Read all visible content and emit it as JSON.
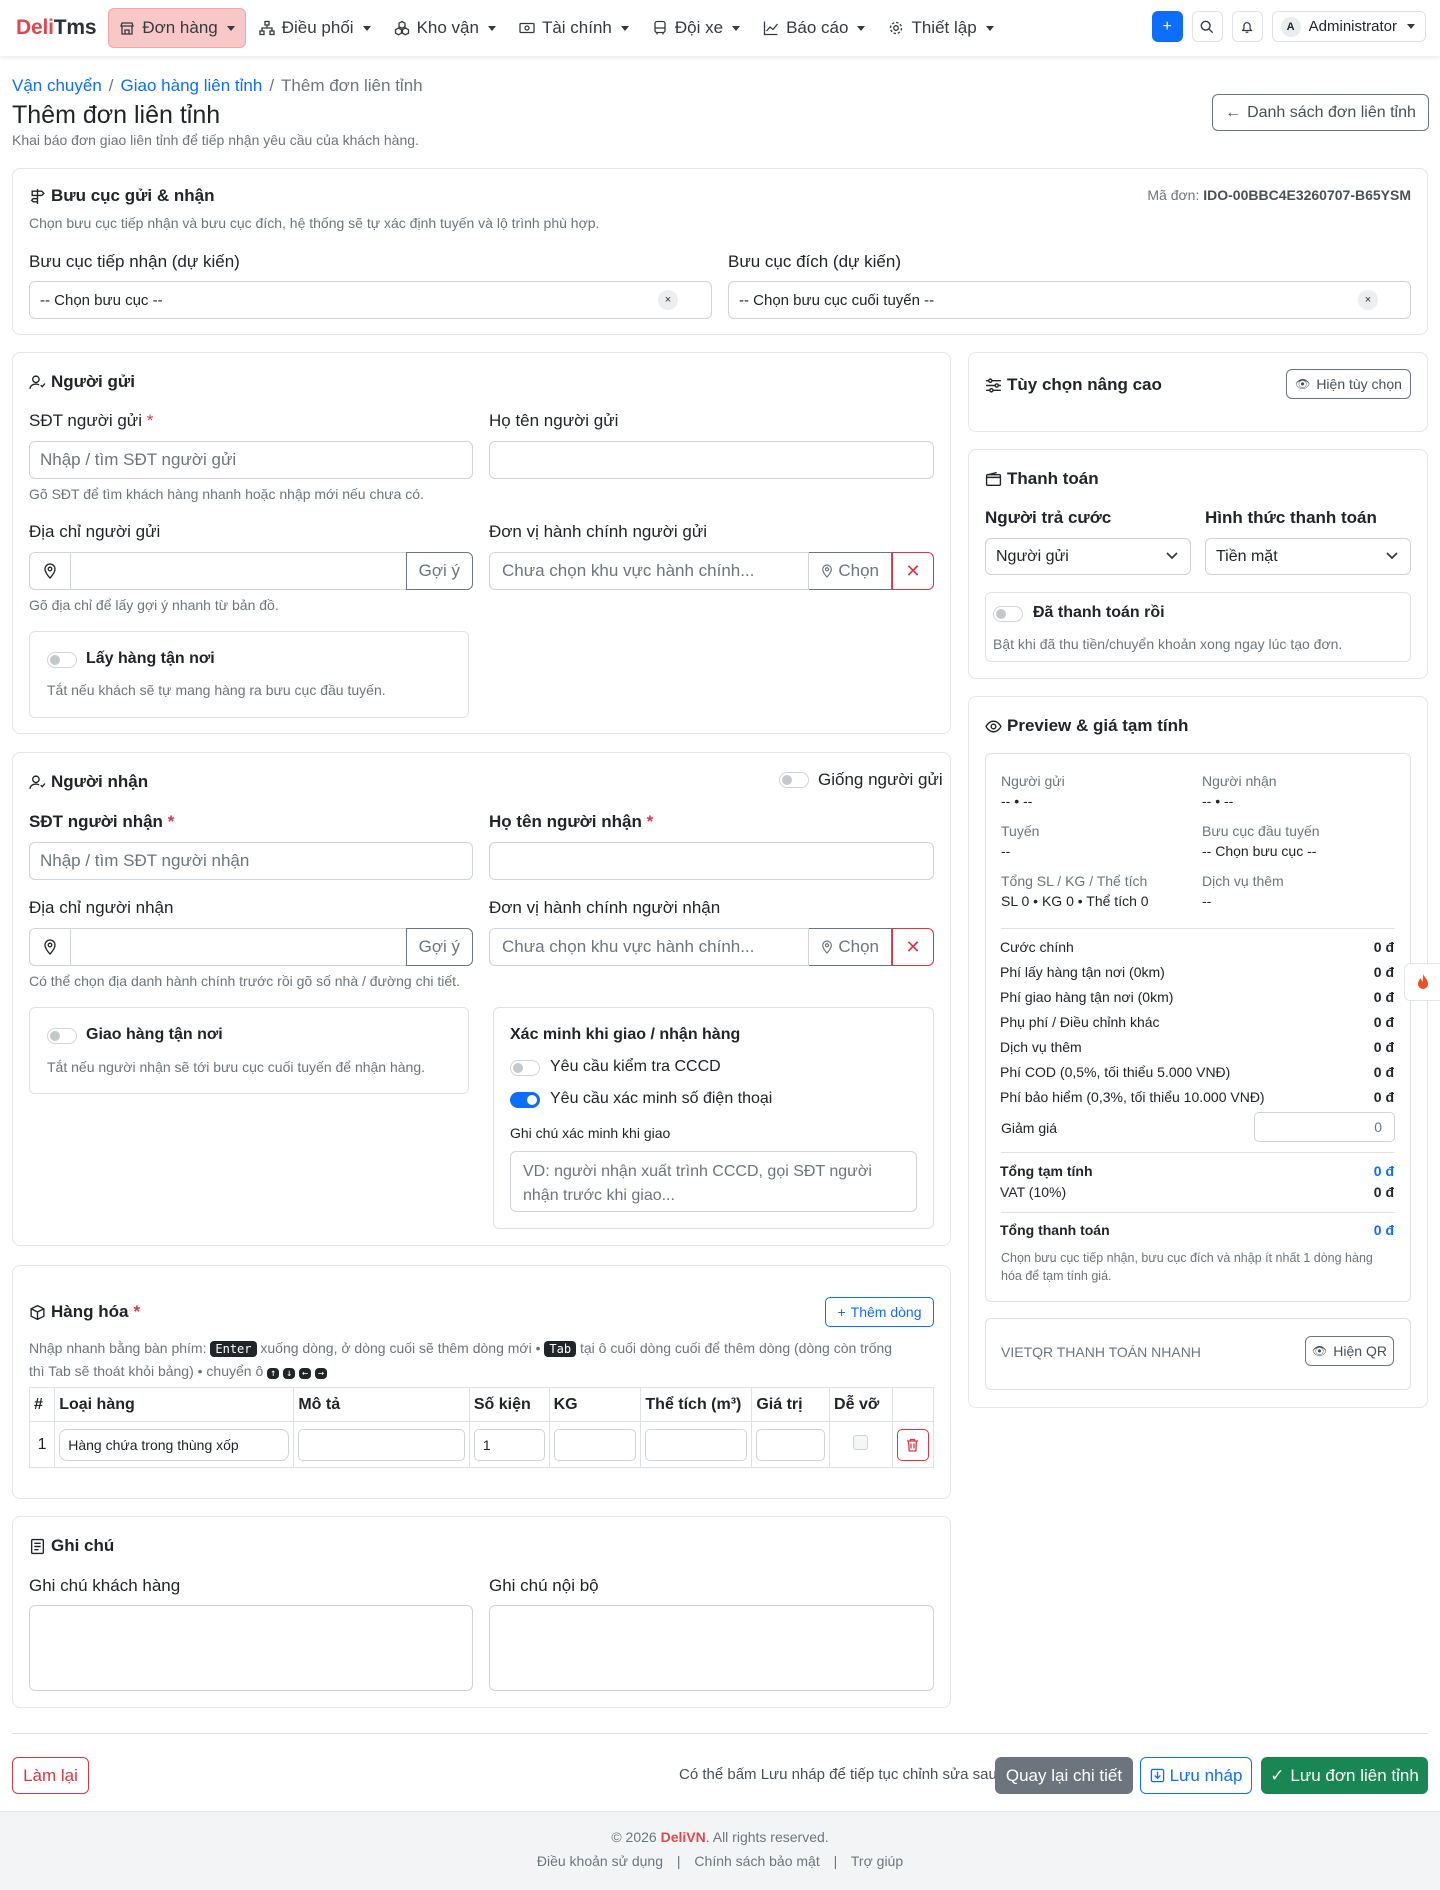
{
  "nav": {
    "brand_a": "Deli",
    "brand_b": "Tms",
    "menu": [
      "Đơn hàng",
      "Điều phối",
      "Kho vận",
      "Tài chính",
      "Đội xe",
      "Báo cáo",
      "Thiết lập"
    ],
    "add_label": "+",
    "user_initial": "A",
    "user_name": "Administrator"
  },
  "breadcrumb": {
    "items": [
      "Vận chuyển",
      "Giao hàng liên tỉnh",
      "Thêm đơn liên tỉnh"
    ]
  },
  "page": {
    "title": "Thêm đơn liên tỉnh",
    "subtitle": "Khai báo đơn giao liên tỉnh để tiếp nhận yêu cầu của khách hàng.",
    "back_button": "Danh sách đơn liên tỉnh"
  },
  "post_office": {
    "title": "Bưu cục gửi & nhận",
    "order_code_label": "Mã đơn:",
    "order_code": "IDO-00BBC4E3260707-B65YSM",
    "desc": "Chọn bưu cục tiếp nhận và bưu cục đích, hệ thống sẽ tự xác định tuyến và lộ trình phù hợp.",
    "origin_label": "Bưu cục tiếp nhận (dự kiến)",
    "origin_value": "-- Chọn bưu cục --",
    "dest_label": "Bưu cục đích (dự kiến)",
    "dest_value": "-- Chọn bưu cục cuối tuyến --",
    "clear": "×"
  },
  "sender": {
    "title": "Người gửi",
    "phone_label": "SĐT người gửi",
    "phone_placeholder": "Nhập / tìm SĐT người gửi",
    "phone_help": "Gõ SĐT để tìm khách hàng nhanh hoặc nhập mới nếu chưa có.",
    "name_label": "Họ tên người gửi",
    "addr_label": "Địa chỉ người gửi",
    "suggest": "Gợi ý",
    "addr_help": "Gõ địa chỉ để lấy gợi ý nhanh từ bản đồ.",
    "admin_label": "Đơn vị hành chính người gửi",
    "admin_placeholder": "Chưa chọn khu vực hành chính...",
    "choose": "Chọn",
    "pickup_title": "Lấy hàng tận nơi",
    "pickup_desc": "Tắt nếu khách sẽ tự mang hàng ra bưu cục đầu tuyến."
  },
  "receiver": {
    "title": "Người nhận",
    "same_label": "Giống người gửi",
    "phone_label": "SĐT người nhận",
    "phone_placeholder": "Nhập / tìm SĐT người nhận",
    "name_label": "Họ tên người nhận",
    "addr_label": "Địa chỉ người nhận",
    "suggest": "Gợi ý",
    "addr_help": "Có thể chọn địa danh hành chính trước rồi gõ số nhà / đường chi tiết.",
    "admin_label": "Đơn vị hành chính người nhận",
    "admin_placeholder": "Chưa chọn khu vực hành chính...",
    "choose": "Chọn",
    "delivery_title": "Giao hàng tận nơi",
    "delivery_desc": "Tắt nếu người nhận sẽ tới bưu cục cuối tuyến để nhận hàng.",
    "verify_title": "Xác minh khi giao / nhận hàng",
    "verify_cccd": "Yêu cầu kiểm tra CCCD",
    "verify_phone": "Yêu cầu xác minh số điện thoại",
    "verify_note_label": "Ghi chú xác minh khi giao",
    "verify_note_placeholder": "VD: người nhận xuất trình CCCD, gọi SĐT người nhận trước khi giao..."
  },
  "goods": {
    "title": "Hàng hóa",
    "add_row": "Thêm dòng",
    "hint_1": "Nhập nhanh bằng bàn phím:",
    "key_enter": "Enter",
    "hint_2": "xuống dòng, ở dòng cuối sẽ thêm dòng mới •",
    "key_tab": "Tab",
    "hint_3": "tại ô cuối dòng cuối để thêm dòng (dòng còn trống",
    "hint_4": "thì Tab sẽ thoát khỏi bảng) • chuyển ô",
    "arrows": [
      "↑",
      "↓",
      "←",
      "→"
    ],
    "columns": [
      "#",
      "Loại hàng",
      "Mô tả",
      "Số kiện",
      "KG",
      "Thể tích (m³)",
      "Giá trị",
      "Dễ vỡ"
    ],
    "rows": [
      {
        "no": "1",
        "type": "Hàng chứa trong thùng xốp",
        "desc": "",
        "qty": "1",
        "kg": "",
        "vol": "",
        "value": ""
      }
    ]
  },
  "notes": {
    "title": "Ghi chú",
    "customer_label": "Ghi chú khách hàng",
    "internal_label": "Ghi chú nội bộ"
  },
  "advanced": {
    "title": "Tùy chọn nâng cao",
    "show": "Hiện tùy chọn"
  },
  "payment": {
    "title": "Thanh toán",
    "payer_label": "Người trả cước",
    "payer_value": "Người gửi",
    "method_label": "Hình thức thanh toán",
    "method_value": "Tiền mặt",
    "paid_title": "Đã thanh toán rồi",
    "paid_desc": "Bật khi đã thu tiền/chuyển khoản xong ngay lúc tạo đơn."
  },
  "preview": {
    "title": "Preview & giá tạm tính",
    "sender_label": "Người gửi",
    "sender_value": "-- • --",
    "receiver_label": "Người nhận",
    "receiver_value": "-- • --",
    "route_label": "Tuyến",
    "route_value": "--",
    "first_office_label": "Bưu cục đầu tuyến",
    "first_office_value": "-- Chọn bưu cục --",
    "total_label": "Tổng SL / KG / Thể tích",
    "total_value": "SL 0 • KG 0 • Thể tích 0",
    "extra_label": "Dịch vụ thêm",
    "extra_value": "--",
    "fees": [
      {
        "label": "Cước chính",
        "value": "0 đ"
      },
      {
        "label": "Phí lấy hàng tận nơi (0km)",
        "value": "0 đ"
      },
      {
        "label": "Phí giao hàng tận nơi (0km)",
        "value": "0 đ"
      },
      {
        "label": "Phụ phí / Điều chỉnh khác",
        "value": "0 đ"
      },
      {
        "label": "Dịch vụ thêm",
        "value": "0 đ"
      },
      {
        "label": "Phí COD (0,5%, tối thiểu 5.000 VNĐ)",
        "value": "0 đ"
      },
      {
        "label": "Phí bảo hiểm (0,3%, tối thiểu 10.000 VNĐ)",
        "value": "0 đ"
      }
    ],
    "discount_label": "Giảm giá",
    "discount_value": "0",
    "subtotal_label": "Tổng tạm tính",
    "subtotal_value": "0 đ",
    "vat_label": "VAT (10%)",
    "vat_value": "0 đ",
    "grand_label": "Tổng thanh toán",
    "grand_value": "0 đ",
    "note": "Chọn bưu cục tiếp nhận, bưu cục đích và nhập ít nhất 1 dòng hàng hóa để tạm tính giá.",
    "vietqr_label": "VIETQR THANH TOÁN NHANH",
    "qr_button": "Hiện QR"
  },
  "actions": {
    "reset": "Làm lại",
    "hint": "Có thể bấm Lưu nháp để tiếp tục chỉnh sửa sau.",
    "back": "Quay lại chi tiết",
    "draft": "Lưu nháp",
    "save": "Lưu đơn liên tỉnh"
  },
  "footer": {
    "copyright_pre": "© 2026",
    "brand": "DeliVN",
    "copyright_post": ". All rights reserved.",
    "links": [
      "Điều khoản sử dụng",
      "Chính sách bảo mật",
      "Trợ giúp"
    ]
  },
  "colors": {
    "primary": "#0d6efd",
    "danger": "#dc3545",
    "success": "#198754",
    "brand": "#e4474b"
  }
}
